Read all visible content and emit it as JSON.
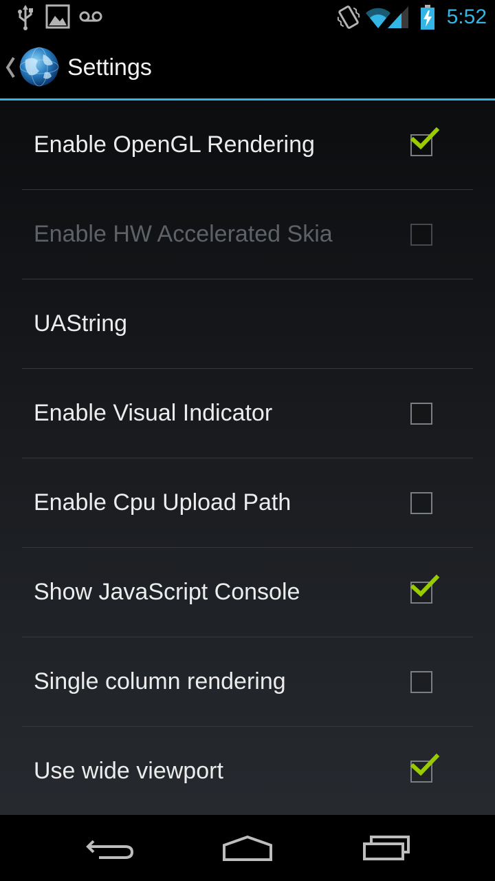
{
  "status_bar": {
    "time": "5:52",
    "time_color": "#33b5e5",
    "icons": [
      "usb-icon",
      "picture-notification-icon",
      "voicemail-icon",
      "vibrate-icon",
      "wifi-icon",
      "signal-icon",
      "battery-charging-icon"
    ]
  },
  "action_bar": {
    "title": "Settings",
    "logo_icon": "globe-icon",
    "up_icon": "chevron-left-icon",
    "divider_color": "#33b5e5"
  },
  "preferences": [
    {
      "title": "Enable OpenGL Rendering",
      "has_checkbox": true,
      "checked": true,
      "enabled": true
    },
    {
      "title": "Enable HW Accelerated Skia",
      "has_checkbox": true,
      "checked": false,
      "enabled": false
    },
    {
      "title": "UAString",
      "has_checkbox": false,
      "checked": false,
      "enabled": true
    },
    {
      "title": "Enable Visual Indicator",
      "has_checkbox": true,
      "checked": false,
      "enabled": true
    },
    {
      "title": "Enable Cpu Upload Path",
      "has_checkbox": true,
      "checked": false,
      "enabled": true
    },
    {
      "title": "Show JavaScript Console",
      "has_checkbox": true,
      "checked": true,
      "enabled": true
    },
    {
      "title": "Single column rendering",
      "has_checkbox": true,
      "checked": false,
      "enabled": true
    },
    {
      "title": "Use wide viewport",
      "has_checkbox": true,
      "checked": true,
      "enabled": true
    }
  ],
  "check_color": "#99cc00",
  "navigation_bar": {
    "buttons": [
      "back-icon",
      "home-icon",
      "recent-apps-icon"
    ]
  }
}
